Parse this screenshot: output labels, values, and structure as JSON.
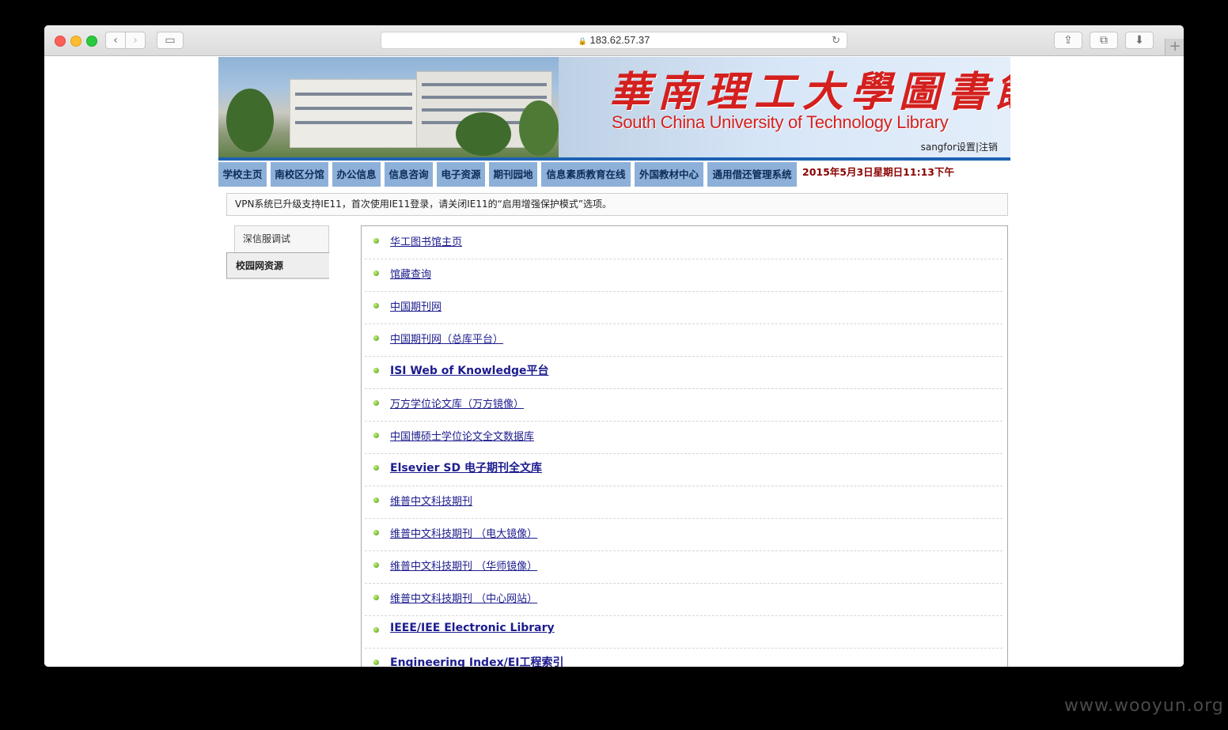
{
  "browser": {
    "url": "183.62.57.37",
    "back_glyph": "‹",
    "forward_glyph": "›",
    "sidebar_glyph": "▭",
    "reload_glyph": "↻",
    "share_glyph": "⇪",
    "tabs_glyph": "⧉",
    "download_glyph": "⬇",
    "newtab_glyph": "+",
    "lock_glyph": "🔒"
  },
  "header": {
    "title_cn": "華南理工大學圖書館",
    "title_en": "South China University of Technology Library",
    "user": "sangfor",
    "settings": "设置",
    "separator": "|",
    "logout": "注销"
  },
  "nav": {
    "items": [
      "学校主页",
      "南校区分馆",
      "办公信息",
      "信息咨询",
      "电子资源",
      "期刊园地",
      "信息素质教育在线",
      "外国教材中心",
      "通用借还管理系统"
    ],
    "date": "2015年5月3日星期日11:13下午"
  },
  "notice": "VPN系统已升级支持IE11，首次使用IE11登录，请关闭IE11的“启用增强保护模式”选项。",
  "left_menu": {
    "item1": "深信服调试",
    "item2": "校园网资源"
  },
  "resources": [
    "华工图书馆主页",
    "馆藏查询",
    "中国期刊网",
    "中国期刊网（总库平台）",
    "ISI Web of Knowledge平台",
    "万方学位论文库（万方镜像）",
    "中国博硕士学位论文全文数据库",
    "Elsevier SD 电子期刊全文库",
    "维普中文科技期刊",
    "维普中文科技期刊 （电大镜像）",
    "维普中文科技期刊 （华师镜像）",
    "维普中文科技期刊 （中心网站）",
    "IEEE/IEE Electronic Library",
    "Engineering Index/EI工程索引"
  ],
  "watermark": "www.wooyun.org",
  "colors": {
    "accent": "#1d62b3",
    "title_red": "#d4201e",
    "nav_bg": "#8db0d8",
    "date_red": "#8a0000",
    "link": "#1c1c8e"
  }
}
